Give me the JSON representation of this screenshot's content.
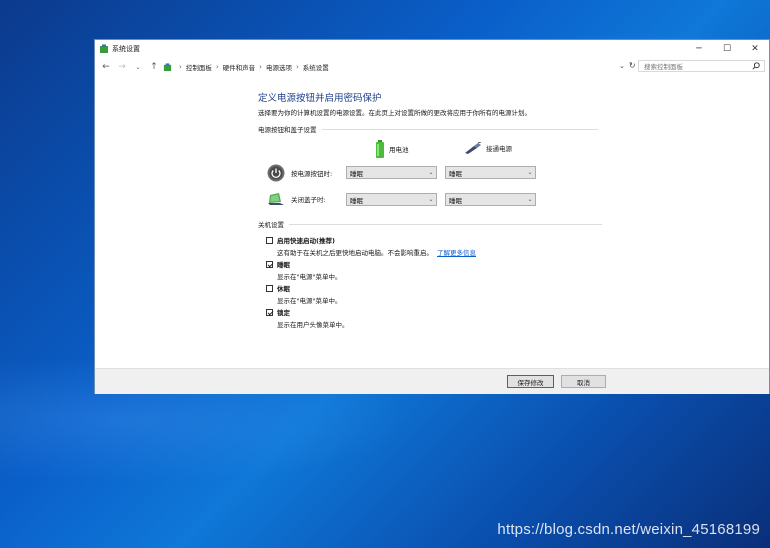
{
  "desktop": {
    "watermark": "https://blog.csdn.net/weixin_45168199"
  },
  "window": {
    "title": "系统设置",
    "controls": {
      "minimize": "─",
      "maximize": "☐",
      "close": "✕"
    }
  },
  "addressbar": {
    "crumbs": [
      "控制面板",
      "硬件和声音",
      "电源选项",
      "系统设置"
    ],
    "search_placeholder": "搜索控制面板"
  },
  "page": {
    "heading": "定义电源按钮并启用密码保护",
    "subtitle": "选择要为你的计算机设置的电源设置。在此页上对设置所做的更改将应用于你所有的电源计划。",
    "power_section": {
      "label": "电源按钮和盖子设置",
      "columns": {
        "battery": "用电池",
        "plugged": "接通电源"
      },
      "rows": [
        {
          "label": "按电源按钮时:",
          "battery_value": "睡眠",
          "plugged_value": "睡眠"
        },
        {
          "label": "关闭盖子时:",
          "battery_value": "睡眠",
          "plugged_value": "睡眠"
        }
      ]
    },
    "shutdown_section": {
      "label": "关机设置",
      "options": [
        {
          "name": "启用快速启动(推荐)",
          "desc": "这有助于在关机之后更快地启动电脑。不会影响重启。",
          "link": "了解更多信息",
          "checked": false
        },
        {
          "name": "睡眠",
          "desc": "显示在\"电源\"菜单中。",
          "checked": true
        },
        {
          "name": "休眠",
          "desc": "显示在\"电源\"菜单中。",
          "checked": false
        },
        {
          "name": "锁定",
          "desc": "显示在用户头像菜单中。",
          "checked": true
        }
      ]
    }
  },
  "footer": {
    "save": "保存修改",
    "cancel": "取消"
  }
}
